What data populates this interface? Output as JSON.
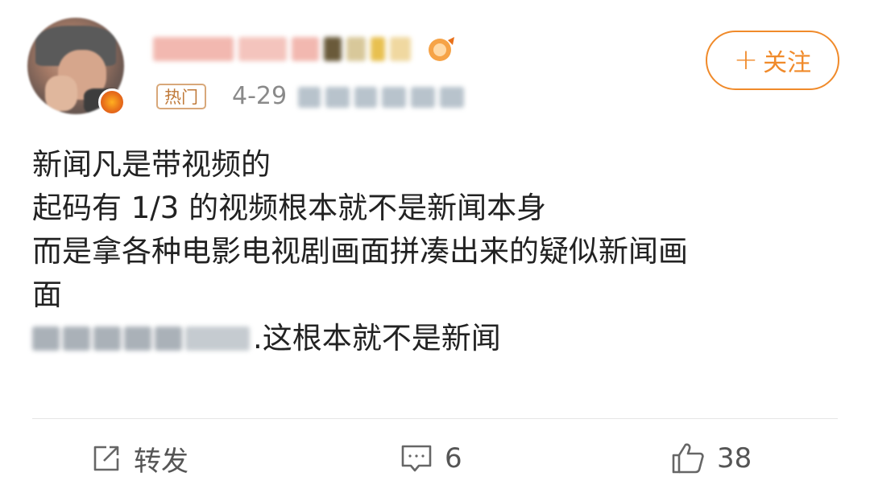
{
  "post": {
    "hot_tag": "热门",
    "date": "4-29",
    "follow_label": "关注",
    "content": {
      "line1": "新闻凡是带视频的",
      "line2": "起码有 1/3 的视频根本就不是新闻本身",
      "line3": "而是拿各种电影电视剧画面拼凑出来的疑似新闻画",
      "line4": "面",
      "line5_suffix": ".这根本就不是新闻"
    },
    "actions": {
      "repost_label": "转发",
      "comment_count": "6",
      "like_count": "38"
    }
  },
  "colors": {
    "accent": "#f08a2a",
    "text": "#222222",
    "muted": "#8a8a8a",
    "action": "#555555",
    "hot_tag": "#c07a3a"
  },
  "icons": {
    "repost": "repost-icon",
    "comment": "comment-icon",
    "like": "thumbs-up-icon",
    "vip": "vip-badge-icon",
    "follow": "plus-icon"
  }
}
